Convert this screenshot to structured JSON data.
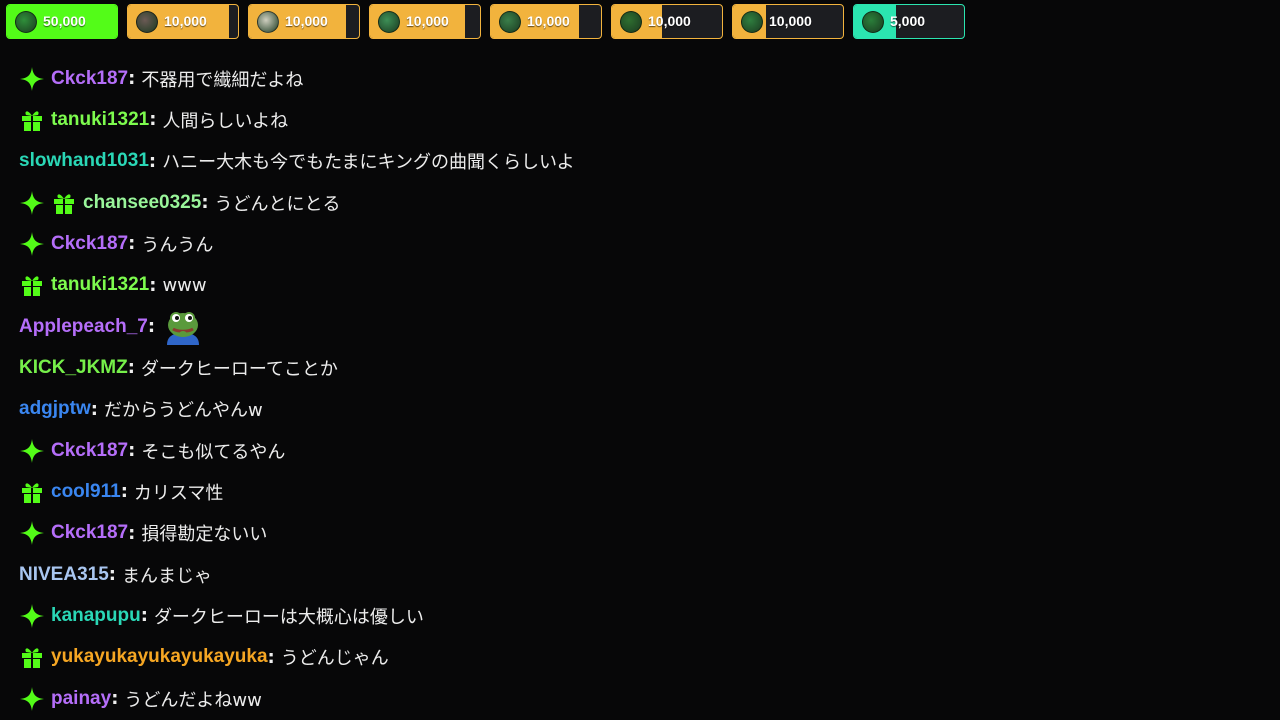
{
  "colors": {
    "background": "#070708",
    "pin_gold": "#f2b33d",
    "pin_green": "#53fc18",
    "pin_teal": "#2be5b0",
    "badge_green": "#53fc18"
  },
  "pinned_gifts": [
    {
      "amount": "50,000",
      "fill": 1.0,
      "fill_color": "#53fc18",
      "border_color": "#53fc18",
      "avatar_color": "#2f8f3a",
      "avatar_icon": "green-avatar-icon"
    },
    {
      "amount": "10,000",
      "fill": 0.92,
      "fill_color": "#f2b33d",
      "border_color": "#f2b33d",
      "avatar_color": "#6b5a55",
      "avatar_icon": "person-avatar-icon"
    },
    {
      "amount": "10,000",
      "fill": 0.88,
      "fill_color": "#f2b33d",
      "border_color": "#f2b33d",
      "avatar_color": "#cfcfbf",
      "avatar_icon": "light-avatar-icon"
    },
    {
      "amount": "10,000",
      "fill": 0.86,
      "fill_color": "#f2b33d",
      "border_color": "#f2b33d",
      "avatar_color": "#3d8f56",
      "avatar_icon": "green-character-avatar-icon"
    },
    {
      "amount": "10,000",
      "fill": 0.8,
      "fill_color": "#f2b33d",
      "border_color": "#f2b33d",
      "avatar_color": "#3a7f4a",
      "avatar_icon": "green-character-avatar-icon"
    },
    {
      "amount": "10,000",
      "fill": 0.45,
      "fill_color": "#f2b33d",
      "border_color": "#f2b33d",
      "avatar_color": "#2f6f30",
      "avatar_icon": "frog-avatar-icon"
    },
    {
      "amount": "10,000",
      "fill": 0.3,
      "fill_color": "#f2b33d",
      "border_color": "#f2b33d",
      "avatar_color": "#2f7f3f",
      "avatar_icon": "green-avatar-icon"
    },
    {
      "amount": "5,000",
      "fill": 0.38,
      "fill_color": "#2be5b0",
      "border_color": "#2be5b0",
      "avatar_color": "#2a7f3a",
      "avatar_icon": "green-avatar-icon"
    }
  ],
  "messages": [
    {
      "badges": [
        "sparkle"
      ],
      "user": "Ckck187",
      "color": "#b56ef9",
      "text": "不器用で繊細だよね"
    },
    {
      "badges": [
        "gift"
      ],
      "user": "tanuki1321",
      "color": "#7dfb4e",
      "text": "人間らしいよね"
    },
    {
      "badges": [],
      "user": "slowhand1031",
      "color": "#2ad7b6",
      "text": "ハニー大木も今でもたまにキングの曲聞くらしいよ"
    },
    {
      "badges": [
        "sparkle",
        "gift"
      ],
      "user": "chansee0325",
      "color": "#99f59a",
      "text": "うどんとにとる"
    },
    {
      "badges": [
        "sparkle"
      ],
      "user": "Ckck187",
      "color": "#b56ef9",
      "text": "うんうん"
    },
    {
      "badges": [
        "gift"
      ],
      "user": "tanuki1321",
      "color": "#7dfb4e",
      "text": "www"
    },
    {
      "badges": [],
      "user": "Applepeach_7",
      "color": "#b56ef9",
      "text": "",
      "emote": "pepe-frog-emote"
    },
    {
      "badges": [],
      "user": "KICK_JKMZ",
      "color": "#76f04a",
      "text": "ダークヒーローてことか"
    },
    {
      "badges": [],
      "user": "adgjptw",
      "color": "#3a86f0",
      "text": "だからうどんやんw"
    },
    {
      "badges": [
        "sparkle"
      ],
      "user": "Ckck187",
      "color": "#b56ef9",
      "text": "そこも似てるやん"
    },
    {
      "badges": [
        "gift"
      ],
      "user": "cool911",
      "color": "#3a86f0",
      "text": "カリスマ性"
    },
    {
      "badges": [
        "sparkle"
      ],
      "user": "Ckck187",
      "color": "#b56ef9",
      "text": "損得勘定ないい"
    },
    {
      "badges": [],
      "user": "NIVEA315",
      "color": "#a9c6f0",
      "text": "まんまじゃ"
    },
    {
      "badges": [
        "sparkle"
      ],
      "user": "kanapupu",
      "color": "#2ad7b6",
      "text": "ダークヒーローは大概心は優しい"
    },
    {
      "badges": [
        "gift"
      ],
      "user": "yukayukayukayukayuka",
      "color": "#f5a623",
      "text": "うどんじゃん"
    },
    {
      "badges": [
        "sparkle"
      ],
      "user": "painay",
      "color": "#b56ef9",
      "text": "うどんだよねww"
    }
  ]
}
